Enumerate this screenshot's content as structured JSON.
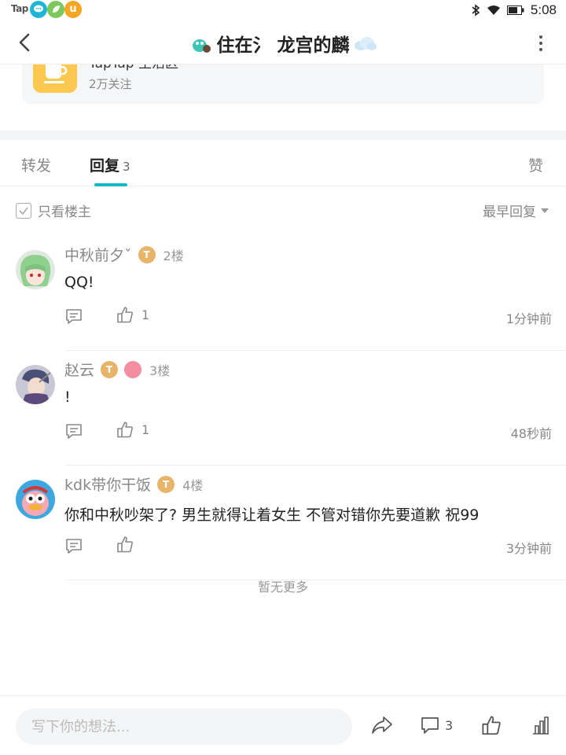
{
  "statusbar": {
    "app_logo": "Tap",
    "notif_icons": [
      "chat-bubble-icon",
      "leaf-icon",
      "u-icon"
    ],
    "notif_u_label": "u",
    "system_icons": [
      "bluetooth-icon",
      "wifi-icon",
      "battery-icon"
    ],
    "time": "5:08"
  },
  "navbar": {
    "title": "住在氵 龙宫的麟",
    "title_prefix_icon": "creature-emoji-icon",
    "title_suffix_icon": "cloud-emoji-icon"
  },
  "group": {
    "name": "TapTap 生活区",
    "follow_count": "2万关注",
    "logo_icon": "coffee-cup-icon"
  },
  "tabs": [
    {
      "label": "转发",
      "count": ""
    },
    {
      "label": "回复",
      "count": "3"
    },
    {
      "label": "赞",
      "count": ""
    }
  ],
  "filter": {
    "only_op_label": "只看楼主",
    "sort_label": "最早回复"
  },
  "replies": [
    {
      "name": "中秋前夕ˇ",
      "floor": "2楼",
      "text": "QQ!",
      "likes": "1",
      "time": "1分钟前"
    },
    {
      "name": "赵云",
      "floor": "3楼",
      "text": "!",
      "likes": "1",
      "time": "48秒前"
    },
    {
      "name": "kdk带你干饭",
      "floor": "4楼",
      "text": "你和中秋吵架了? 男生就得让着女生 不管对错你先要道歉 祝99",
      "likes": "",
      "time": "3分钟前"
    }
  ],
  "badge_t": "T",
  "no_more": "暂无更多",
  "bottombar": {
    "input_placeholder": "写下你的想法...",
    "comment_count": "3"
  },
  "colors": {
    "accent": "#14b9c8",
    "group_logo": "#fcc84f"
  }
}
